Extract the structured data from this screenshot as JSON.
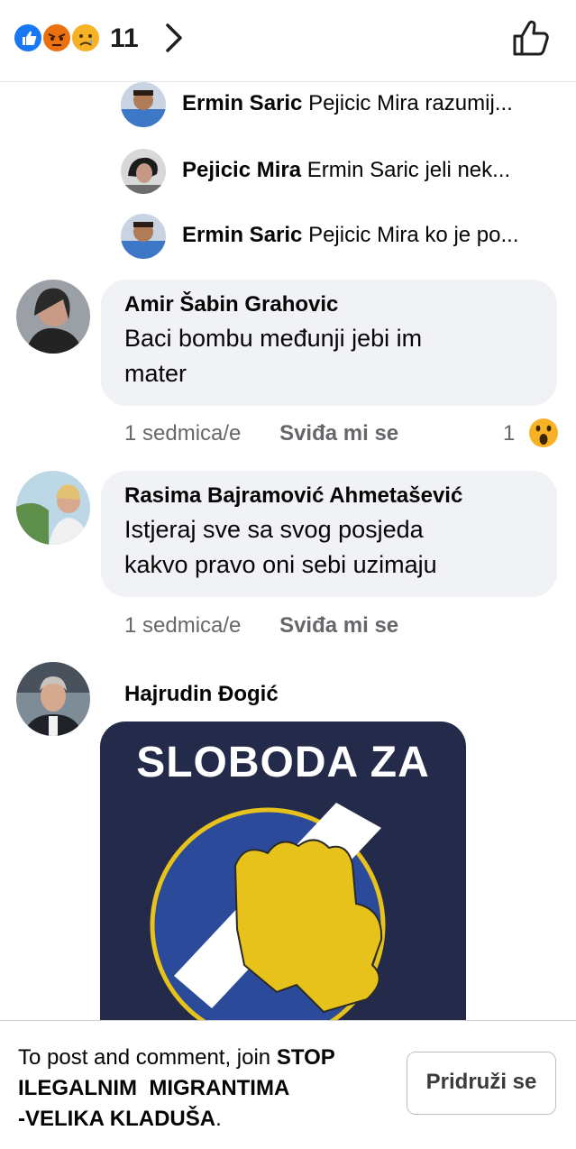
{
  "header": {
    "reaction_count": "11",
    "reactions": [
      "like-icon",
      "angry-icon",
      "sad-icon"
    ]
  },
  "replies": [
    {
      "name": "Ermin Saric",
      "text": "Pejicic Mira razumij..."
    },
    {
      "name": "Pejicic Mira",
      "text": "Ermin Saric jeli nek..."
    },
    {
      "name": "Ermin Saric",
      "text": "Pejicic Mira ko je po..."
    }
  ],
  "comments": [
    {
      "name": "Amir Šabin Grahovic",
      "lines": [
        "Baci bombu međunji jebi im",
        "mater"
      ],
      "time": "1 sedmica/e",
      "like_label": "Sviđa mi se",
      "reaction_count": "1"
    },
    {
      "name": "Rasima Bajramović Ahmetašević",
      "lines": [
        "Istjeraj sve sa svog posjeda",
        "kakvo pravo oni sebi uzimaju"
      ],
      "time": "1 sedmica/e",
      "like_label": "Sviđa mi se"
    },
    {
      "name": "Hajrudin Đogić",
      "image_text": "SLOBODA ZA"
    }
  ],
  "footer": {
    "prefix": "To post and comment, join ",
    "group_name_line1": "STOP",
    "group_name_line2": "ILEGALNIM  MIGRANTIMA",
    "group_name_line3": "-VELIKA KLADUŠA",
    "suffix": ".",
    "join_label": "Pridruži se"
  },
  "colors": {
    "bubble": "#f0f2f5",
    "meta_text": "#65676b",
    "poster_bg": "#242b4a",
    "poster_yellow": "#e7c21a"
  }
}
